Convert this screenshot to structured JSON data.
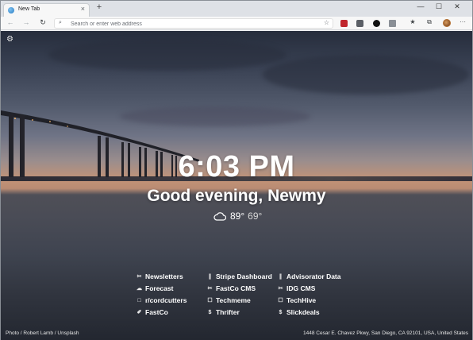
{
  "tab": {
    "title": "New Tab",
    "close_glyph": "×",
    "favicon": "edge-logo-icon"
  },
  "tabstrip": {
    "new_tab_glyph": "+",
    "minimize_glyph": "—",
    "maximize_glyph": "☐",
    "close_glyph": "✕"
  },
  "toolbar": {
    "back_glyph": "←",
    "forward_glyph": "→",
    "refresh_glyph": "↻",
    "address_placeholder": "Search or enter web address",
    "search_glyph": "⌕",
    "favorite_glyph": "☆",
    "favorites_bar_glyph": "★",
    "collections_glyph": "⧉",
    "more_glyph": "···"
  },
  "page": {
    "settings_glyph": "⚙",
    "time": "6:03 PM",
    "greeting": "Good evening, Newmy",
    "weather": {
      "icon": "cloud-icon",
      "high": "89°",
      "low": "69°"
    },
    "links": [
      {
        "icon": "✂",
        "label": "Newsletters"
      },
      {
        "icon": "☁",
        "label": "Forecast"
      },
      {
        "icon": "□",
        "label": "r/cordcutters"
      },
      {
        "icon": "✐",
        "label": "FastCo"
      },
      {
        "icon": "∥",
        "label": "Stripe Dashboard"
      },
      {
        "icon": "✂",
        "label": "FastCo CMS"
      },
      {
        "icon": "☐",
        "label": "Techmeme"
      },
      {
        "icon": "$",
        "label": "Thrifter"
      },
      {
        "icon": "∥",
        "label": "Advisorator Data"
      },
      {
        "icon": "✂",
        "label": "IDG CMS"
      },
      {
        "icon": "☐",
        "label": "TechHive"
      },
      {
        "icon": "$",
        "label": "Slickdeals"
      }
    ],
    "photo_credit": "Photo / Robert Lamb / Unsplash",
    "photo_location": "1448 Cesar E. Chavez Pkwy, San Diego, CA 92101, USA, United States"
  },
  "colors": {
    "accent": "#2b7cc4",
    "text_light": "#ffffff",
    "sky_top": "#262d3c",
    "sunset": "#c39377"
  }
}
